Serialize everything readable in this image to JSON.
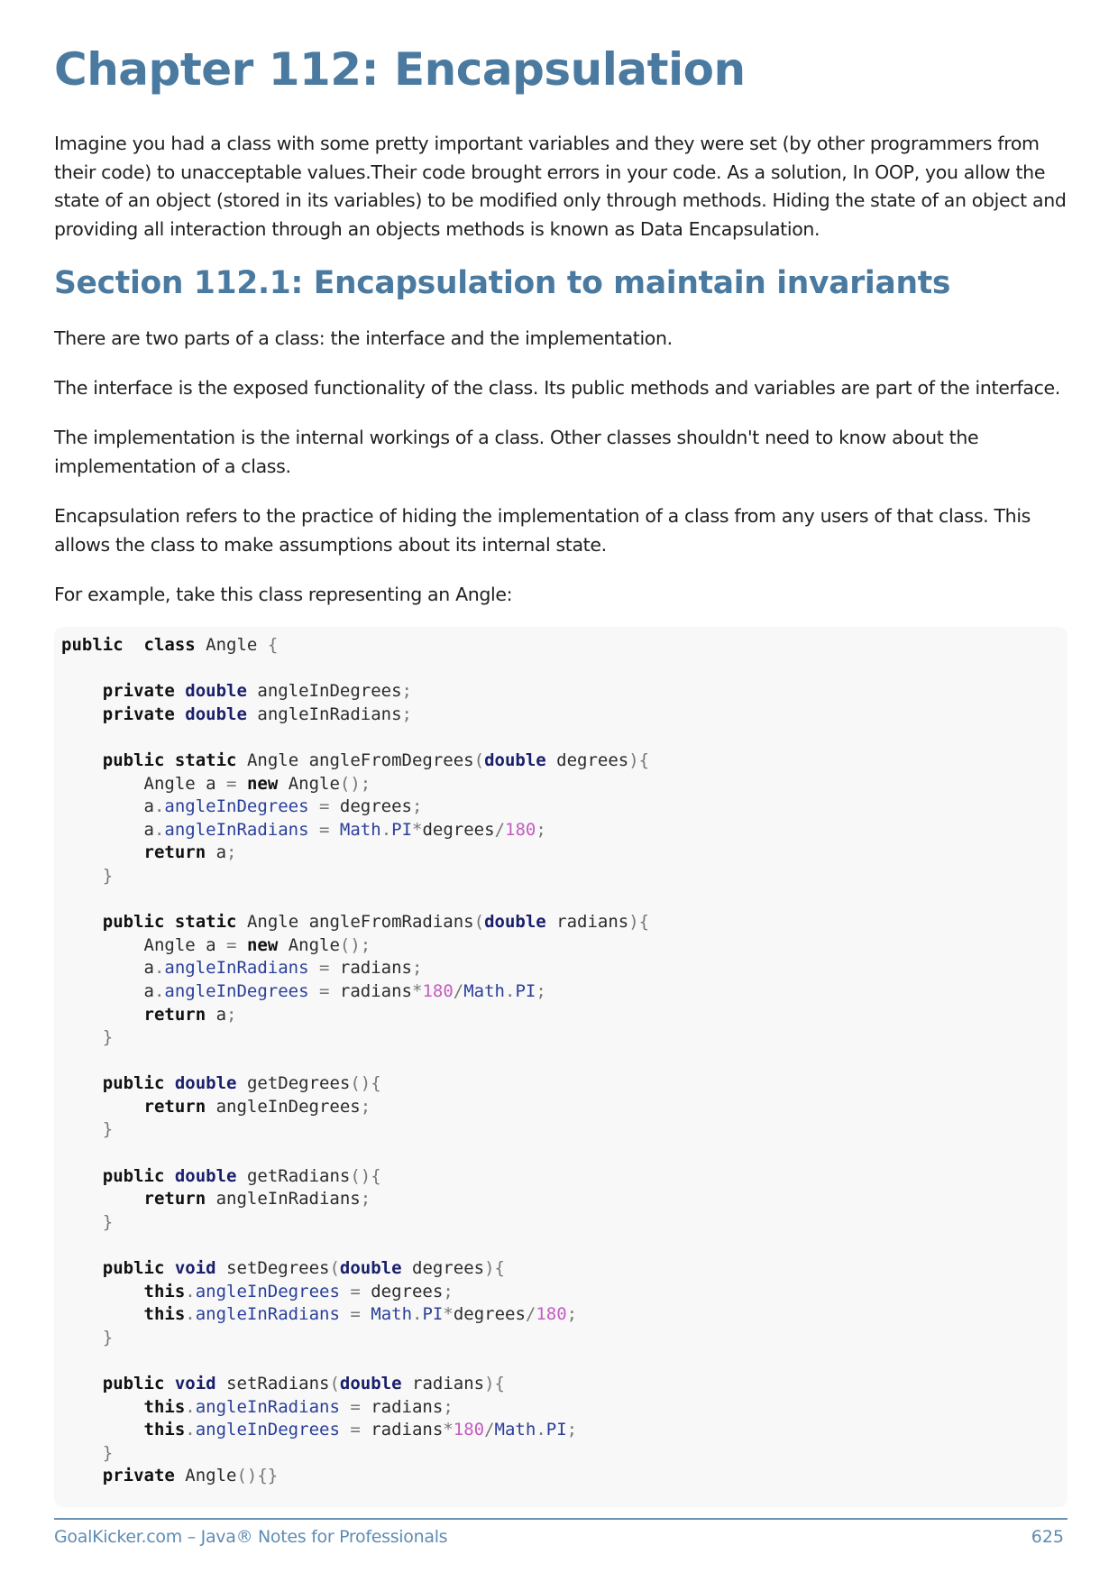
{
  "chapter_title": "Chapter 112: Encapsulation",
  "intro": "Imagine you had a class with some pretty important variables and they were set (by other programmers from their code) to unacceptable values.Their code brought errors in your code. As a solution, In OOP, you allow the state of an object (stored in its variables) to be modified only through methods. Hiding the state of an object and providing all interaction through an objects methods is known as Data Encapsulation.",
  "section_title": "Section 112.1: Encapsulation to maintain invariants",
  "paragraphs": [
    "There are two parts of a class: the interface and the implementation.",
    "The interface is the exposed functionality of the class. Its public methods and variables are part of the interface.",
    "The implementation is the internal workings of a class. Other classes shouldn't need to know about the implementation of a class.",
    "Encapsulation refers to the practice of hiding the implementation of a class from any users of that class. This allows the class to make assumptions about its internal state.",
    "For example, take this class representing an Angle:"
  ],
  "code": [
    [
      [
        "kw",
        "public"
      ],
      [
        "",
        "  "
      ],
      [
        "kw",
        "class"
      ],
      [
        "",
        " Angle "
      ],
      [
        "pun",
        "{"
      ]
    ],
    [],
    [
      [
        "",
        "    "
      ],
      [
        "kw",
        "private"
      ],
      [
        "",
        " "
      ],
      [
        "ty",
        "double"
      ],
      [
        "",
        " angleInDegrees"
      ],
      [
        "pun",
        ";"
      ]
    ],
    [
      [
        "",
        "    "
      ],
      [
        "kw",
        "private"
      ],
      [
        "",
        " "
      ],
      [
        "ty",
        "double"
      ],
      [
        "",
        " angleInRadians"
      ],
      [
        "pun",
        ";"
      ]
    ],
    [],
    [
      [
        "",
        "    "
      ],
      [
        "kw",
        "public"
      ],
      [
        "",
        " "
      ],
      [
        "kw",
        "static"
      ],
      [
        "",
        " Angle angleFromDegrees"
      ],
      [
        "pun",
        "("
      ],
      [
        "ty",
        "double"
      ],
      [
        "",
        " degrees"
      ],
      [
        "pun",
        "){"
      ]
    ],
    [
      [
        "",
        "        Angle a "
      ],
      [
        "pun",
        "="
      ],
      [
        "",
        " "
      ],
      [
        "kw",
        "new"
      ],
      [
        "",
        " Angle"
      ],
      [
        "pun",
        "();"
      ]
    ],
    [
      [
        "",
        "        a"
      ],
      [
        "pun",
        "."
      ],
      [
        "fld",
        "angleInDegrees"
      ],
      [
        "",
        " "
      ],
      [
        "pun",
        "="
      ],
      [
        "",
        " degrees"
      ],
      [
        "pun",
        ";"
      ]
    ],
    [
      [
        "",
        "        a"
      ],
      [
        "pun",
        "."
      ],
      [
        "fld",
        "angleInRadians"
      ],
      [
        "",
        " "
      ],
      [
        "pun",
        "="
      ],
      [
        "",
        " "
      ],
      [
        "fld",
        "Math"
      ],
      [
        "pun",
        "."
      ],
      [
        "fld",
        "PI"
      ],
      [
        "pun",
        "*"
      ],
      [
        "",
        "degrees"
      ],
      [
        "pun",
        "/"
      ],
      [
        "num",
        "180"
      ],
      [
        "pun",
        ";"
      ]
    ],
    [
      [
        "",
        "        "
      ],
      [
        "kw",
        "return"
      ],
      [
        "",
        " a"
      ],
      [
        "pun",
        ";"
      ]
    ],
    [
      [
        "",
        "    "
      ],
      [
        "pun",
        "}"
      ]
    ],
    [],
    [
      [
        "",
        "    "
      ],
      [
        "kw",
        "public"
      ],
      [
        "",
        " "
      ],
      [
        "kw",
        "static"
      ],
      [
        "",
        " Angle angleFromRadians"
      ],
      [
        "pun",
        "("
      ],
      [
        "ty",
        "double"
      ],
      [
        "",
        " radians"
      ],
      [
        "pun",
        "){"
      ]
    ],
    [
      [
        "",
        "        Angle a "
      ],
      [
        "pun",
        "="
      ],
      [
        "",
        " "
      ],
      [
        "kw",
        "new"
      ],
      [
        "",
        " Angle"
      ],
      [
        "pun",
        "();"
      ]
    ],
    [
      [
        "",
        "        a"
      ],
      [
        "pun",
        "."
      ],
      [
        "fld",
        "angleInRadians"
      ],
      [
        "",
        " "
      ],
      [
        "pun",
        "="
      ],
      [
        "",
        " radians"
      ],
      [
        "pun",
        ";"
      ]
    ],
    [
      [
        "",
        "        a"
      ],
      [
        "pun",
        "."
      ],
      [
        "fld",
        "angleInDegrees"
      ],
      [
        "",
        " "
      ],
      [
        "pun",
        "="
      ],
      [
        "",
        " radians"
      ],
      [
        "pun",
        "*"
      ],
      [
        "num",
        "180"
      ],
      [
        "pun",
        "/"
      ],
      [
        "fld",
        "Math"
      ],
      [
        "pun",
        "."
      ],
      [
        "fld",
        "PI"
      ],
      [
        "pun",
        ";"
      ]
    ],
    [
      [
        "",
        "        "
      ],
      [
        "kw",
        "return"
      ],
      [
        "",
        " a"
      ],
      [
        "pun",
        ";"
      ]
    ],
    [
      [
        "",
        "    "
      ],
      [
        "pun",
        "}"
      ]
    ],
    [],
    [
      [
        "",
        "    "
      ],
      [
        "kw",
        "public"
      ],
      [
        "",
        " "
      ],
      [
        "ty",
        "double"
      ],
      [
        "",
        " getDegrees"
      ],
      [
        "pun",
        "(){"
      ]
    ],
    [
      [
        "",
        "        "
      ],
      [
        "kw",
        "return"
      ],
      [
        "",
        " angleInDegrees"
      ],
      [
        "pun",
        ";"
      ]
    ],
    [
      [
        "",
        "    "
      ],
      [
        "pun",
        "}"
      ]
    ],
    [],
    [
      [
        "",
        "    "
      ],
      [
        "kw",
        "public"
      ],
      [
        "",
        " "
      ],
      [
        "ty",
        "double"
      ],
      [
        "",
        " getRadians"
      ],
      [
        "pun",
        "(){"
      ]
    ],
    [
      [
        "",
        "        "
      ],
      [
        "kw",
        "return"
      ],
      [
        "",
        " angleInRadians"
      ],
      [
        "pun",
        ";"
      ]
    ],
    [
      [
        "",
        "    "
      ],
      [
        "pun",
        "}"
      ]
    ],
    [],
    [
      [
        "",
        "    "
      ],
      [
        "kw",
        "public"
      ],
      [
        "",
        " "
      ],
      [
        "ty",
        "void"
      ],
      [
        "",
        " setDegrees"
      ],
      [
        "pun",
        "("
      ],
      [
        "ty",
        "double"
      ],
      [
        "",
        " degrees"
      ],
      [
        "pun",
        "){"
      ]
    ],
    [
      [
        "",
        "        "
      ],
      [
        "kw",
        "this"
      ],
      [
        "pun",
        "."
      ],
      [
        "fld",
        "angleInDegrees"
      ],
      [
        "",
        " "
      ],
      [
        "pun",
        "="
      ],
      [
        "",
        " degrees"
      ],
      [
        "pun",
        ";"
      ]
    ],
    [
      [
        "",
        "        "
      ],
      [
        "kw",
        "this"
      ],
      [
        "pun",
        "."
      ],
      [
        "fld",
        "angleInRadians"
      ],
      [
        "",
        " "
      ],
      [
        "pun",
        "="
      ],
      [
        "",
        " "
      ],
      [
        "fld",
        "Math"
      ],
      [
        "pun",
        "."
      ],
      [
        "fld",
        "PI"
      ],
      [
        "pun",
        "*"
      ],
      [
        "",
        "degrees"
      ],
      [
        "pun",
        "/"
      ],
      [
        "num",
        "180"
      ],
      [
        "pun",
        ";"
      ]
    ],
    [
      [
        "",
        "    "
      ],
      [
        "pun",
        "}"
      ]
    ],
    [],
    [
      [
        "",
        "    "
      ],
      [
        "kw",
        "public"
      ],
      [
        "",
        " "
      ],
      [
        "ty",
        "void"
      ],
      [
        "",
        " setRadians"
      ],
      [
        "pun",
        "("
      ],
      [
        "ty",
        "double"
      ],
      [
        "",
        " radians"
      ],
      [
        "pun",
        "){"
      ]
    ],
    [
      [
        "",
        "        "
      ],
      [
        "kw",
        "this"
      ],
      [
        "pun",
        "."
      ],
      [
        "fld",
        "angleInRadians"
      ],
      [
        "",
        " "
      ],
      [
        "pun",
        "="
      ],
      [
        "",
        " radians"
      ],
      [
        "pun",
        ";"
      ]
    ],
    [
      [
        "",
        "        "
      ],
      [
        "kw",
        "this"
      ],
      [
        "pun",
        "."
      ],
      [
        "fld",
        "angleInDegrees"
      ],
      [
        "",
        " "
      ],
      [
        "pun",
        "="
      ],
      [
        "",
        " radians"
      ],
      [
        "pun",
        "*"
      ],
      [
        "num",
        "180"
      ],
      [
        "pun",
        "/"
      ],
      [
        "fld",
        "Math"
      ],
      [
        "pun",
        "."
      ],
      [
        "fld",
        "PI"
      ],
      [
        "pun",
        ";"
      ]
    ],
    [
      [
        "",
        "    "
      ],
      [
        "pun",
        "}"
      ]
    ],
    [
      [
        "",
        "    "
      ],
      [
        "kw",
        "private"
      ],
      [
        "",
        " Angle"
      ],
      [
        "pun",
        "(){}"
      ]
    ]
  ],
  "footer": {
    "left": "GoalKicker.com – Java® Notes for Professionals",
    "page_number": "625"
  },
  "colors": {
    "heading": "#4a7aa0",
    "footer": "#5e8cb3",
    "code_background": "#f8f8f8",
    "code_number": "#c45cc0",
    "code_field": "#2a3f9a",
    "code_type": "#1a1f6b"
  }
}
